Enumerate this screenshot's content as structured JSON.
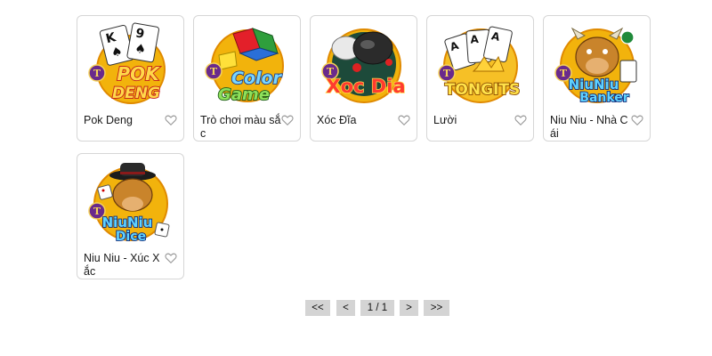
{
  "games": [
    {
      "title": "Pok Deng",
      "logo_text": [
        "POK",
        "DENG"
      ],
      "badge": "T",
      "cards": [
        "K",
        "9"
      ]
    },
    {
      "title": "Trò chơi màu sắc",
      "logo_text": [
        "Color",
        "Game"
      ],
      "badge": "T"
    },
    {
      "title": "Xóc Đĩa",
      "logo_text": [
        "Xoc Dia"
      ],
      "badge": "T"
    },
    {
      "title": "Lười",
      "logo_text": [
        "TONGITS"
      ],
      "badge": "T",
      "cards": [
        "A",
        "A",
        "A"
      ]
    },
    {
      "title": "Niu Niu - Nhà Cái",
      "logo_text": [
        "NiuNiu",
        "Banker"
      ],
      "badge": "T"
    },
    {
      "title": "Niu Niu - Xúc Xắc",
      "logo_text": [
        "NiuNiu",
        "Dice"
      ],
      "badge": "T"
    }
  ],
  "favorite_icon": "heart-outline-icon",
  "pagination": {
    "first": "<<",
    "prev": "<",
    "page_info": "1 / 1",
    "next": ">",
    "last": ">>"
  },
  "colors": {
    "logo_gold": "#f5b800",
    "card_border": "#d6d6d6",
    "pager_bg": "#d4d4d4"
  }
}
